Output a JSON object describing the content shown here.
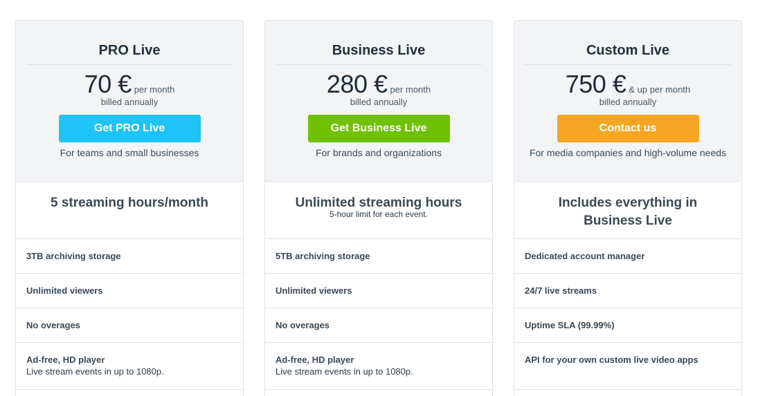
{
  "plans": [
    {
      "name": "PRO Live",
      "price": "70 €",
      "per": "per month",
      "billed": "billed annually",
      "cta": "Get PRO Live",
      "cta_color": "#1ec3f7",
      "audience": "For teams and small businesses",
      "headline": "5 streaming hours/month",
      "headline_note": "",
      "features": [
        {
          "title": "3TB archiving storage",
          "sub": ""
        },
        {
          "title": "Unlimited viewers",
          "sub": ""
        },
        {
          "title": "No overages",
          "sub": ""
        },
        {
          "title": "Ad-free, HD player",
          "sub": "Live stream events in up to 1080p."
        }
      ]
    },
    {
      "name": "Business Live",
      "price": "280 €",
      "per": "per month",
      "billed": "billed annually",
      "cta": "Get Business Live",
      "cta_color": "#6ec203",
      "audience": "For brands and organizations",
      "headline": "Unlimited streaming hours",
      "headline_note": "5-hour limit for each event.",
      "features": [
        {
          "title": "5TB archiving storage",
          "sub": ""
        },
        {
          "title": "Unlimited viewers",
          "sub": ""
        },
        {
          "title": "No overages",
          "sub": ""
        },
        {
          "title": "Ad-free, HD player",
          "sub": "Live stream events in up to 1080p."
        }
      ]
    },
    {
      "name": "Custom Live",
      "price": "750 €",
      "per": "& up per month",
      "billed": "billed annually",
      "cta": "Contact us",
      "cta_color": "#f5a623",
      "audience": "For media companies and high-volume needs",
      "headline": "Includes everything in Business Live",
      "headline_note": "",
      "features": [
        {
          "title": "Dedicated account manager",
          "sub": ""
        },
        {
          "title": "24/7 live streams",
          "sub": ""
        },
        {
          "title": "Uptime SLA (99.99%)",
          "sub": ""
        },
        {
          "title": "API for your own custom live video apps",
          "sub": ""
        }
      ]
    }
  ]
}
